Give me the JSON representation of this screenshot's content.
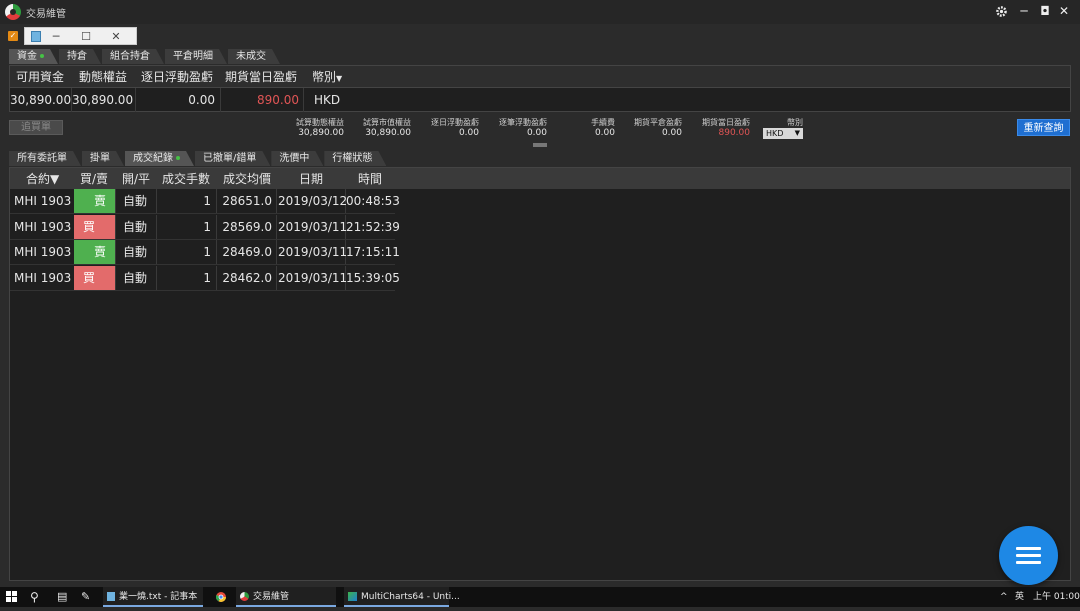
{
  "window": {
    "title": "交易維管"
  },
  "mini_window": {
    "minimize": "─",
    "maximize": "☐",
    "close": "✕"
  },
  "top_tabs": [
    {
      "label": "資金",
      "active": true,
      "dot": true
    },
    {
      "label": "持倉"
    },
    {
      "label": "組合持倉"
    },
    {
      "label": "平倉明細"
    },
    {
      "label": "未成交"
    }
  ],
  "funds": {
    "headers": [
      "可用資金",
      "動態權益",
      "逐日浮動盈虧",
      "期貨當日盈虧",
      "幣別"
    ],
    "values": [
      "30,890.00",
      "30,890.00",
      "0.00",
      "890.00",
      "HKD"
    ],
    "filter_icon": "▼"
  },
  "summary": {
    "labels": [
      "試算動態權益",
      "試算市值權益",
      "逐日浮動盈虧",
      "逐筆浮動盈虧",
      "手續費",
      "期貨平倉盈虧",
      "期貨當日盈虧",
      "幣別"
    ],
    "values": [
      "30,890.00",
      "30,890.00",
      "0.00",
      "0.00",
      "0.00",
      "0.00",
      "890.00"
    ],
    "currency_select": "HKD",
    "left_button": "追買單",
    "query_button": "重新查詢"
  },
  "bottom_tabs": [
    {
      "label": "所有委託單"
    },
    {
      "label": "掛單"
    },
    {
      "label": "成交紀錄",
      "active": true,
      "dot": true
    },
    {
      "label": "已撤單/錯單"
    },
    {
      "label": "洗價中"
    },
    {
      "label": "行權狀態"
    }
  ],
  "trades": {
    "headers": [
      "合約▼",
      "買/賣",
      "開/平",
      "成交手數",
      "成交均價",
      "日期",
      "時間"
    ],
    "rows": [
      {
        "contract": "MHI 1903",
        "side": "賣",
        "side_type": "sell",
        "open_close": "自動",
        "qty": "1",
        "price": "28651.0",
        "date": "2019/03/12",
        "time": "00:48:53"
      },
      {
        "contract": "MHI 1903",
        "side": "買",
        "side_type": "buy",
        "open_close": "自動",
        "qty": "1",
        "price": "28569.0",
        "date": "2019/03/11",
        "time": "21:52:39"
      },
      {
        "contract": "MHI 1903",
        "side": "賣",
        "side_type": "sell",
        "open_close": "自動",
        "qty": "1",
        "price": "28469.0",
        "date": "2019/03/11",
        "time": "17:15:11"
      },
      {
        "contract": "MHI 1903",
        "side": "買",
        "side_type": "buy",
        "open_close": "自動",
        "qty": "1",
        "price": "28462.0",
        "date": "2019/03/11",
        "time": "15:39:05"
      }
    ]
  },
  "taskbar": {
    "items": [
      "業一燒.txt - 記事本",
      "交易維管",
      "MultiCharts64 - Unti..."
    ],
    "lang": "英",
    "clock": "上午 01:00",
    "tray_arrow": "^"
  },
  "colors": {
    "buy": "#e36b6b",
    "sell": "#4fb04f",
    "accent": "#1f6fd1",
    "loss_red": "#e05555"
  }
}
